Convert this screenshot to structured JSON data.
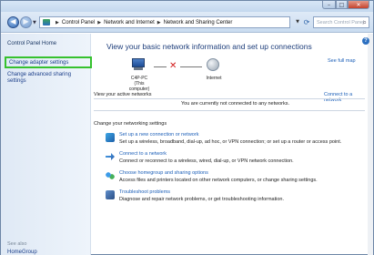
{
  "window": {
    "controls": {
      "minimize": "–",
      "maximize": "□",
      "close": "✕"
    }
  },
  "address_bar": {
    "breadcrumbs": [
      "Control Panel",
      "Network and Internet",
      "Network and Sharing Center"
    ],
    "search_placeholder": "Search Control Panel"
  },
  "left_pane": {
    "home": "Control Panel Home",
    "links": [
      "Change adapter settings",
      "Change advanced sharing settings"
    ],
    "see_also": "See also",
    "see_also_links": [
      "HomeGroup"
    ]
  },
  "main": {
    "heading": "View your basic network information and set up connections",
    "see_full_map": "See full map",
    "computer_name": "C4P-PC",
    "computer_sub": "(This computer)",
    "internet_label": "Internet",
    "active_networks_label": "View your active networks",
    "connect_to_network": "Connect to a network",
    "not_connected": "You are currently not connected to any networks.",
    "change_settings_label": "Change your networking settings",
    "tasks": [
      {
        "icon": "new-connection-icon",
        "link": "Set up a new connection or network",
        "desc": "Set up a wireless, broadband, dial-up, ad hoc, or VPN connection; or set up a router or access point."
      },
      {
        "icon": "connect-network-icon",
        "link": "Connect to a network",
        "desc": "Connect or reconnect to a wireless, wired, dial-up, or VPN network connection."
      },
      {
        "icon": "homegroup-icon",
        "link": "Choose homegroup and sharing options",
        "desc": "Access files and printers located on other network computers, or change sharing settings."
      },
      {
        "icon": "troubleshoot-icon",
        "link": "Troubleshoot problems",
        "desc": "Diagnose and repair network problems, or get troubleshooting information."
      }
    ]
  },
  "colors": {
    "link": "#1c5fb8",
    "heading": "#1d3d7a",
    "highlight_box": "#36c12e",
    "error_x": "#d21a1a"
  }
}
